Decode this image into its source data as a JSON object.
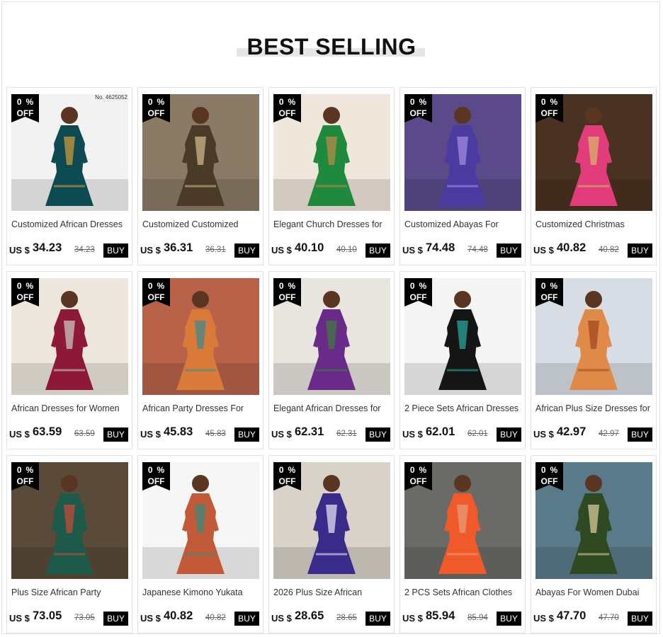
{
  "heading": "BEST SELLING",
  "products": [
    {
      "title": "Customized African Dresses",
      "currency": "US $",
      "price": "34.23",
      "old_price": "34.23",
      "buy": "BUY",
      "pct": [
        "0",
        "%"
      ],
      "off": "OFF",
      "bg": "#f2f2f2",
      "fig": "#0e4a52",
      "accent": "#c79a3a",
      "stamp": "No. 4625052"
    },
    {
      "title": "Customized  Customized",
      "currency": "US $",
      "price": "36.31",
      "old_price": "36.31",
      "buy": "BUY",
      "pct": [
        "0",
        "%"
      ],
      "off": "OFF",
      "bg": "#8a7a66",
      "fig": "#4a3a28",
      "accent": "#cdb68a"
    },
    {
      "title": "Elegant Church Dresses for",
      "currency": "US $",
      "price": "40.10",
      "old_price": "40.10",
      "buy": "BUY",
      "pct": [
        "0",
        "%"
      ],
      "off": "OFF",
      "bg": "#efe6dc",
      "fig": "#1f8a3e",
      "accent": "#b58a4a"
    },
    {
      "title": "Customized Abayas For",
      "currency": "US $",
      "price": "74.48",
      "old_price": "74.48",
      "buy": "BUY",
      "pct": [
        "0",
        "%"
      ],
      "off": "OFF",
      "bg": "#5a4a8a",
      "fig": "#4b3aa0",
      "accent": "#9f8ae0"
    },
    {
      "title": "Customized Christmas",
      "currency": "US $",
      "price": "40.82",
      "old_price": "40.82",
      "buy": "BUY",
      "pct": [
        "0",
        "%"
      ],
      "off": "OFF",
      "bg": "#4a3222",
      "fig": "#e23d7a",
      "accent": "#d8b070"
    },
    {
      "title": "African Dresses for Women",
      "currency": "US $",
      "price": "63.59",
      "old_price": "63.59",
      "buy": "BUY",
      "pct": [
        "0",
        "%"
      ],
      "off": "OFF",
      "bg": "#ece6dd",
      "fig": "#8e1838",
      "accent": "#c9c4bc"
    },
    {
      "title": "African Party Dresses For",
      "currency": "US $",
      "price": "45.83",
      "old_price": "45.83",
      "buy": "BUY",
      "pct": [
        "0",
        "%"
      ],
      "off": "OFF",
      "bg": "#b8624a",
      "fig": "#d97a3a",
      "accent": "#3f8a8a"
    },
    {
      "title": "Elegant African Dresses for",
      "currency": "US $",
      "price": "62.31",
      "old_price": "62.31",
      "buy": "BUY",
      "pct": [
        "0",
        "%"
      ],
      "off": "OFF",
      "bg": "#e8e4de",
      "fig": "#6a2a8a",
      "accent": "#3e7a3a"
    },
    {
      "title": "2 Piece Sets African Dresses",
      "currency": "US $",
      "price": "62.01",
      "old_price": "62.01",
      "buy": "BUY",
      "pct": [
        "0",
        "%"
      ],
      "off": "OFF",
      "bg": "#f4f4f4",
      "fig": "#151515",
      "accent": "#26a69a"
    },
    {
      "title": "African Plus Size Dresses for",
      "currency": "US $",
      "price": "42.97",
      "old_price": "42.97",
      "buy": "BUY",
      "pct": [
        "0",
        "%"
      ],
      "off": "OFF",
      "bg": "#d8dce4",
      "fig": "#e08a4a",
      "accent": "#a04a22"
    },
    {
      "title": "Plus Size African Party",
      "currency": "US $",
      "price": "73.05",
      "old_price": "73.05",
      "buy": "BUY",
      "pct": [
        "0",
        "%"
      ],
      "off": "OFF",
      "bg": "#5a4a3a",
      "fig": "#1d5a4a",
      "accent": "#c24a3a"
    },
    {
      "title": "Japanese Kimono Yukata",
      "currency": "US $",
      "price": "40.82",
      "old_price": "40.82",
      "buy": "BUY",
      "pct": [
        "0",
        "%"
      ],
      "off": "OFF",
      "bg": "#f6f6f6",
      "fig": "#c25a3a",
      "accent": "#3a8a7a"
    },
    {
      "title": "2026 Plus Size African",
      "currency": "US $",
      "price": "28.65",
      "old_price": "28.65",
      "buy": "BUY",
      "pct": [
        "0",
        "%"
      ],
      "off": "OFF",
      "bg": "#d8d2c8",
      "fig": "#3a2a8a",
      "accent": "#e0e0f0"
    },
    {
      "title": "2 PCS Sets African Clothes",
      "currency": "US $",
      "price": "85.94",
      "old_price": "85.94",
      "buy": "BUY",
      "pct": [
        "0",
        "%"
      ],
      "off": "OFF",
      "bg": "#6a6a66",
      "fig": "#f05a2a",
      "accent": "#e89a7a"
    },
    {
      "title": "Abayas For Women Dubai",
      "currency": "US $",
      "price": "47.70",
      "old_price": "47.70",
      "buy": "BUY",
      "pct": [
        "0",
        "%"
      ],
      "off": "OFF",
      "bg": "#5a7a8a",
      "fig": "#2f4a22",
      "accent": "#d8c89a"
    }
  ]
}
